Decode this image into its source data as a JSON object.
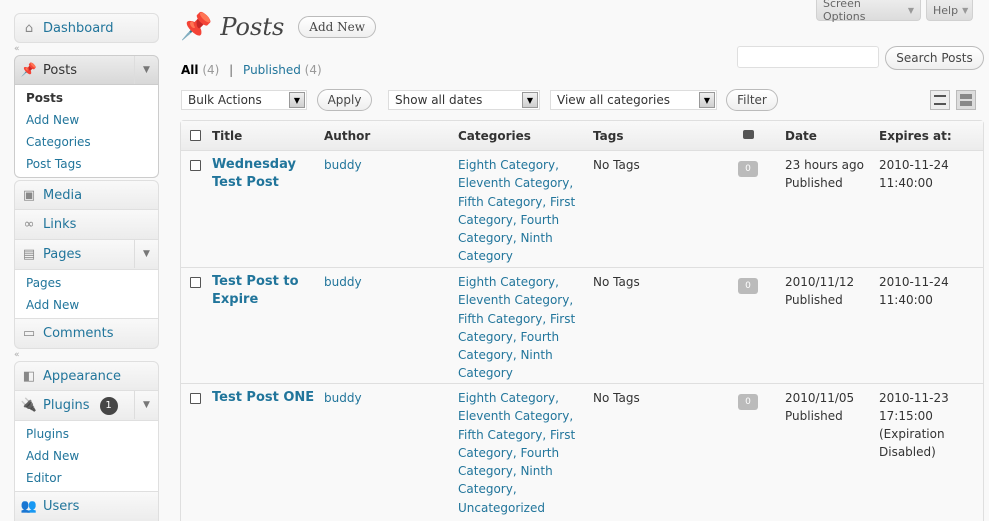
{
  "top_buttons": {
    "screen_options": "Screen Options",
    "help": "Help"
  },
  "sidebar": {
    "dashboard": "Dashboard",
    "posts": {
      "label": "Posts",
      "items": [
        "Posts",
        "Add New",
        "Categories",
        "Post Tags"
      ]
    },
    "media": "Media",
    "links": "Links",
    "pages": {
      "label": "Pages",
      "items": [
        "Pages",
        "Add New"
      ]
    },
    "comments": "Comments",
    "appearance": "Appearance",
    "plugins": {
      "label": "Plugins",
      "badge": "1",
      "items": [
        "Plugins",
        "Add New",
        "Editor"
      ]
    },
    "users": "Users"
  },
  "page": {
    "title": "Posts",
    "add_new": "Add New"
  },
  "search": {
    "button": "Search Posts",
    "placeholder": ""
  },
  "filters": {
    "all": "All",
    "all_count": "(4)",
    "sep": "|",
    "published": "Published",
    "published_count": "(4)"
  },
  "tablenav": {
    "bulk_actions": "Bulk Actions",
    "apply": "Apply",
    "dates": "Show all dates",
    "categories": "View all categories",
    "filter": "Filter"
  },
  "table": {
    "headers": {
      "title": "Title",
      "author": "Author",
      "categories": "Categories",
      "tags": "Tags",
      "date": "Date",
      "expires": "Expires at:"
    },
    "rows": [
      {
        "title": "Wednesday Test Post",
        "author": "buddy",
        "categories": "Eighth Category, Eleventh Category, Fifth Category, First Category, Fourth Category, Ninth Category",
        "tags": "No Tags",
        "comments": "0",
        "date": "23 hours ago",
        "status": "Published",
        "expires": "2010-11-24 11:40:00"
      },
      {
        "title": "Test Post to Expire",
        "author": "buddy",
        "categories": "Eighth Category, Eleventh Category, Fifth Category, First Category, Fourth Category, Ninth Category",
        "tags": "No Tags",
        "comments": "0",
        "date": "2010/11/12",
        "status": "Published",
        "expires": "2010-11-24 11:40:00"
      },
      {
        "title": "Test Post ONE",
        "author": "buddy",
        "categories": "Eighth Category, Eleventh Category, Fifth Category, First Category, Fourth Category, Ninth Category, Uncategorized",
        "tags": "No Tags",
        "comments": "0",
        "date": "2010/11/05",
        "status": "Published",
        "expires": "2010-11-23 17:15:00 (Expiration Disabled)"
      }
    ]
  }
}
